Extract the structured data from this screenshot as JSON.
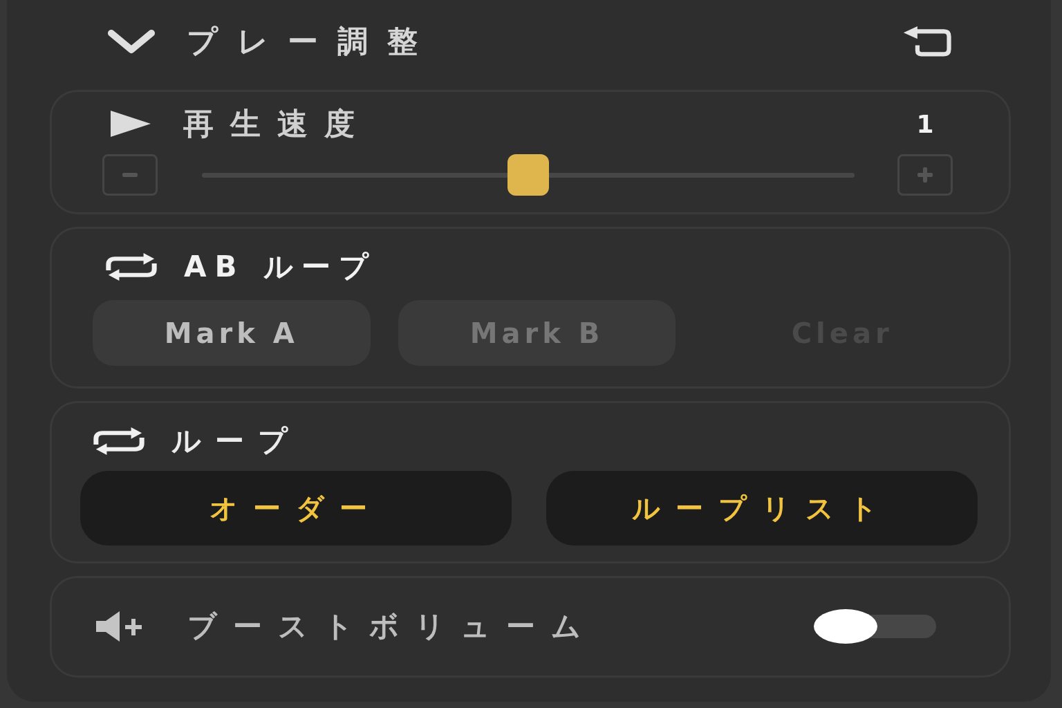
{
  "panel": {
    "title": "プレー調整",
    "expanded": true
  },
  "speed": {
    "label": "再生速度",
    "value": "1",
    "level": 0.5
  },
  "ab_loop": {
    "title": "AB ループ",
    "buttons": [
      {
        "label": "Mark A",
        "kind": "filled",
        "disabled": false
      },
      {
        "label": "Mark B",
        "kind": "filled",
        "disabled": true
      },
      {
        "label": "Clear",
        "kind": "text",
        "disabled": true
      }
    ]
  },
  "loop": {
    "title": "ループ",
    "options": [
      {
        "label": "オーダー"
      },
      {
        "label": "ループリスト"
      }
    ]
  },
  "boost_volume": {
    "label": "ブーストボリューム",
    "on": false
  }
}
